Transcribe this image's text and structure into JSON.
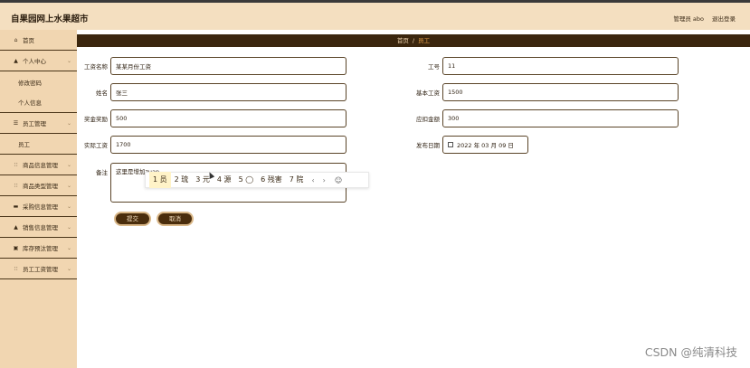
{
  "app": {
    "title": "自果园网上水果超市"
  },
  "user": {
    "role_text": "管理员 abo",
    "logout": "退出登录"
  },
  "sidebar": {
    "items": [
      {
        "label": "首页",
        "icon": "home-icon",
        "glyph": "⌂"
      },
      {
        "label": "个人中心",
        "icon": "person-icon",
        "glyph": "▲",
        "chevron": "⌄"
      },
      {
        "label": "修改密码"
      },
      {
        "label": "个人信息"
      },
      {
        "label": "员工管理",
        "icon": "list-icon",
        "glyph": "☰",
        "chevron": "⌄"
      },
      {
        "label": "员工"
      },
      {
        "label": "商品信息管理",
        "icon": "grid-icon",
        "glyph": "∷",
        "chevron": "⌄"
      },
      {
        "label": "商品类型管理",
        "icon": "grid-icon",
        "glyph": "∷",
        "chevron": "⌄"
      },
      {
        "label": "采购信息管理",
        "icon": "card-icon",
        "glyph": "▬",
        "chevron": "⌄"
      },
      {
        "label": "销售信息管理",
        "icon": "person-icon",
        "glyph": "▲",
        "chevron": "⌄"
      },
      {
        "label": "库存预汰管理",
        "icon": "box-icon",
        "glyph": "▣",
        "chevron": "⌄"
      },
      {
        "label": "员工工资管理",
        "icon": "grid-icon",
        "glyph": "∷",
        "chevron": "⌄"
      }
    ]
  },
  "breadcrumb": {
    "home": "首页",
    "separator": "/",
    "current": "员工"
  },
  "form": {
    "salary_name": {
      "label": "工资名称",
      "value": "某某月份工资"
    },
    "employee_no": {
      "label": "工号",
      "value": "11"
    },
    "name": {
      "label": "姓名",
      "value": "张三"
    },
    "base_salary": {
      "label": "基本工资",
      "value": "1500"
    },
    "bonus": {
      "label": "奖金奖励",
      "value": "500"
    },
    "deduction": {
      "label": "应扣金额",
      "value": "300"
    },
    "actual_salary": {
      "label": "实际工资",
      "value": "1700"
    },
    "pay_date": {
      "label": "发布日期",
      "value": "2022 年 03 月 09 日"
    },
    "remark": {
      "label": "备注",
      "value": "这里是增加zuan"
    },
    "submit": "提交",
    "cancel": "取消"
  },
  "ime": {
    "candidates": [
      "1 员",
      "2 琉",
      "3 元",
      "4 源",
      "5 ◯",
      "6 残害",
      "7 院"
    ],
    "prev": "‹",
    "next": "›",
    "emoji": "☺"
  },
  "watermark": "CSDN @纯清科技"
}
